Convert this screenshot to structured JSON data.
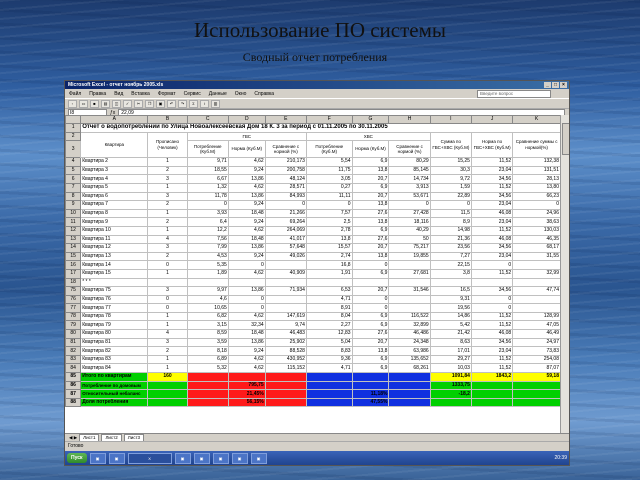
{
  "slide": {
    "title": "Использование ПО системы",
    "subtitle": "Сводный отчет потребления"
  },
  "window": {
    "title": "Microsoft Excel - отчет ноябрь 2005.xls"
  },
  "menu": [
    "Файл",
    "Правка",
    "Вид",
    "Вставка",
    "Формат",
    "Сервис",
    "Данные",
    "Окно",
    "Справка"
  ],
  "help_placeholder": "Введите вопрос",
  "formula": {
    "cell": "I8",
    "value": "22,09"
  },
  "columns": [
    "",
    "A",
    "B",
    "C",
    "D",
    "E",
    "F",
    "G",
    "H",
    "I",
    "J",
    "K"
  ],
  "report_title": "Отчет о водопотреблении по Улица Новоалексеевская  Дом 18 К. 3 за период с 01.11.2005 по 30.11.2005",
  "headers": {
    "kvartira": "Квартира",
    "propisano": "Прописано (Человек)",
    "gvs": "ГВС",
    "hvs": "ХВС",
    "potreb": "Потребление (Куб.М)",
    "norma": "Норма (Куб.М)",
    "sravnenie": "Сравнение с нормой (%)",
    "summa": "Сумма по ГВС+ХВС (Куб.М)",
    "norma_sum": "Норма по ГВС+ХВС (Куб.М)",
    "sravn_sum": "Сравнение суммы с нормой(%)"
  },
  "rows": [
    [
      "4",
      "Квартира 2",
      "1",
      "9,71",
      "4,62",
      "210,173",
      "5,54",
      "6,9",
      "80,29",
      "15,25",
      "11,52",
      "132,38"
    ],
    [
      "5",
      "Квартира 3",
      "2",
      "18,55",
      "9,24",
      "200,758",
      "11,75",
      "13,8",
      "85,145",
      "30,3",
      "23,04",
      "131,51"
    ],
    [
      "6",
      "Квартира 4",
      "3",
      "6,67",
      "13,86",
      "48,124",
      "3,05",
      "20,7",
      "14,734",
      "9,72",
      "34,56",
      "28,13"
    ],
    [
      "7",
      "Квартира 5",
      "1",
      "1,32",
      "4,62",
      "28,571",
      "0,27",
      "6,9",
      "3,913",
      "1,59",
      "11,52",
      "13,80"
    ],
    [
      "8",
      "Квартира 6",
      "3",
      "11,78",
      "13,86",
      "84,993",
      "11,11",
      "20,7",
      "53,671",
      "22,89",
      "34,56",
      "66,23"
    ],
    [
      "9",
      "Квартира 7",
      "2",
      "0",
      "9,24",
      "0",
      "0",
      "13,8",
      "0",
      "0",
      "23,04",
      "0"
    ],
    [
      "10",
      "Квартира 8",
      "1",
      "3,93",
      "18,48",
      "21,266",
      "7,57",
      "27,6",
      "27,428",
      "11,5",
      "46,08",
      "24,96"
    ],
    [
      "11",
      "Квартира 9",
      "2",
      "6,4",
      "9,24",
      "69,264",
      "2,5",
      "13,8",
      "18,116",
      "8,9",
      "23,04",
      "38,63"
    ],
    [
      "12",
      "Квартира 10",
      "1",
      "12,2",
      "4,62",
      "264,069",
      "2,78",
      "6,9",
      "40,29",
      "14,98",
      "11,52",
      "130,03"
    ],
    [
      "13",
      "Квартира 11",
      "4",
      "7,56",
      "18,48",
      "41,017",
      "13,8",
      "27,6",
      "50",
      "21,36",
      "46,08",
      "46,35"
    ],
    [
      "14",
      "Квартира 12",
      "3",
      "7,99",
      "13,86",
      "57,648",
      "15,57",
      "20,7",
      "75,217",
      "23,56",
      "34,56",
      "68,17"
    ],
    [
      "15",
      "Квартира 13",
      "2",
      "4,53",
      "9,24",
      "49,026",
      "2,74",
      "13,8",
      "19,855",
      "7,27",
      "23,04",
      "31,55"
    ],
    [
      "16",
      "Квартира 14",
      "0",
      "5,35",
      "0",
      "",
      "16,8",
      "0",
      "",
      "22,15",
      "0",
      ""
    ],
    [
      "17",
      "Квартира 15",
      "1",
      "1,89",
      "4,62",
      "40,909",
      "1,91",
      "6,9",
      "27,681",
      "3,8",
      "11,52",
      "32,99"
    ],
    [
      "18",
      "* * *",
      "",
      "",
      "",
      "",
      "",
      "",
      "",
      "",
      "",
      ""
    ],
    [
      "75",
      "Квартира 75",
      "3",
      "9,97",
      "13,86",
      "71,934",
      "6,53",
      "20,7",
      "31,546",
      "16,5",
      "34,56",
      "47,74"
    ],
    [
      "76",
      "Квартира 76",
      "0",
      "4,6",
      "0",
      "",
      "4,71",
      "0",
      "",
      "9,31",
      "0",
      ""
    ],
    [
      "77",
      "Квартира 77",
      "0",
      "10,65",
      "0",
      "",
      "8,91",
      "0",
      "",
      "19,56",
      "0",
      ""
    ],
    [
      "78",
      "Квартира 78",
      "1",
      "6,82",
      "4,62",
      "147,619",
      "8,04",
      "6,9",
      "116,522",
      "14,86",
      "11,52",
      "128,99"
    ],
    [
      "79",
      "Квартира 79",
      "1",
      "3,15",
      "32,34",
      "9,74",
      "2,27",
      "6,9",
      "32,899",
      "5,42",
      "11,52",
      "47,05"
    ],
    [
      "80",
      "Квартира 80",
      "4",
      "8,59",
      "18,48",
      "46,483",
      "12,83",
      "27,6",
      "46,486",
      "21,42",
      "46,08",
      "46,49"
    ],
    [
      "81",
      "Квартира 81",
      "3",
      "3,59",
      "13,86",
      "25,902",
      "5,04",
      "20,7",
      "24,348",
      "8,63",
      "34,56",
      "24,97"
    ],
    [
      "82",
      "Квартира 82",
      "2",
      "8,18",
      "9,24",
      "88,528",
      "8,83",
      "13,8",
      "63,986",
      "17,01",
      "23,04",
      "73,83"
    ],
    [
      "83",
      "Квартира 83",
      "1",
      "6,89",
      "4,62",
      "430,952",
      "9,36",
      "6,9",
      "135,652",
      "29,27",
      "11,52",
      "254,08"
    ],
    [
      "84",
      "Квартира 84",
      "1",
      "5,32",
      "4,62",
      "115,152",
      "4,71",
      "6,9",
      "68,261",
      "10,03",
      "11,52",
      "87,07"
    ]
  ],
  "totals": {
    "row85": {
      "label": "Итого по квартирам",
      "count": "160",
      "summa": "1091,84",
      "norma": "1843,2",
      "sravn": "59,18"
    },
    "row86": {
      "label": "Потребление по домовым",
      "gvs": "795,75",
      "summa": "1333,75"
    },
    "row87": {
      "label": "Относительный небаланс",
      "gvs": "21,45%",
      "hvs": "11,18%",
      "summa": "-18,2"
    },
    "row88": {
      "label": "Доля потребления",
      "gvs": "56,15%",
      "hvs": "47,55%"
    }
  },
  "sheet_tabs": [
    "Лист1",
    "Лист2",
    "Лист3"
  ],
  "status": "Готово",
  "taskbar": {
    "start": "Пуск",
    "clock": "20:39"
  },
  "colors": {
    "green": "#00d000",
    "red": "#ff1a1a",
    "blue": "#1030e0",
    "yellow": "#ffff00"
  }
}
